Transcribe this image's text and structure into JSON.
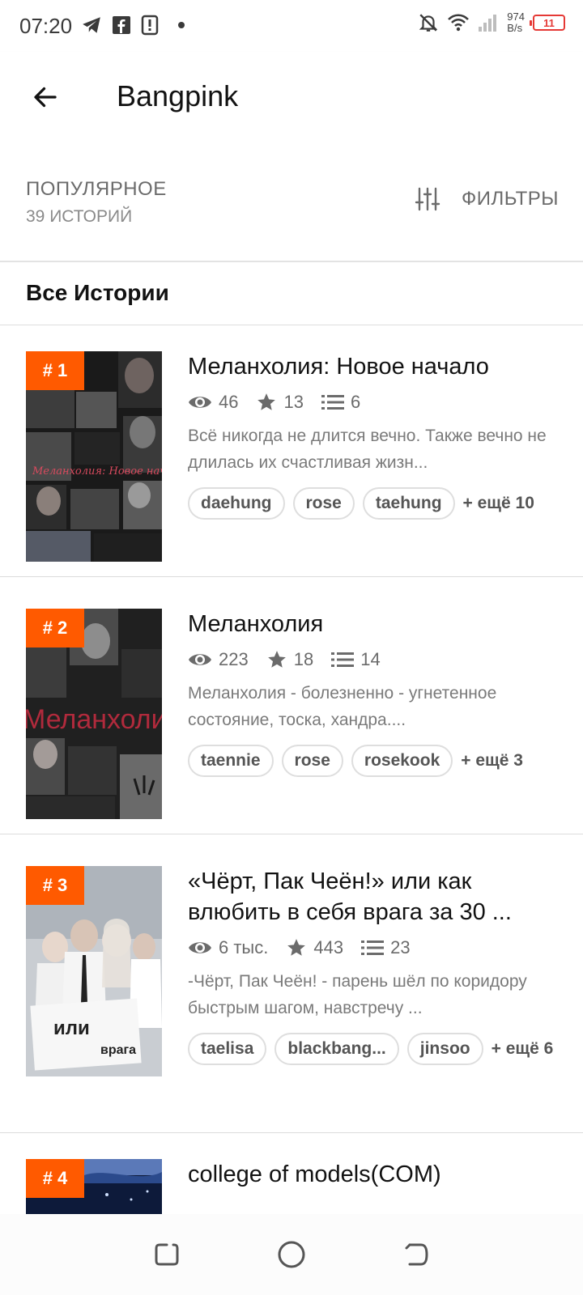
{
  "status_bar": {
    "time": "07:20",
    "net_speed_value": "974",
    "net_speed_unit": "B/s",
    "battery": "11"
  },
  "app_bar": {
    "title": "Bangpink"
  },
  "sort": {
    "title": "ПОПУЛЯРНОЕ",
    "count": "39 ИСТОРИЙ",
    "filters_label": "ФИЛЬТРЫ"
  },
  "section": {
    "title": "Все Истории"
  },
  "colors": {
    "accent": "#ff5a00",
    "text": "#121212",
    "muted": "#6b6b6b"
  },
  "stories": [
    {
      "rank": "# 1",
      "title": "Меланхолия: Новое начало",
      "views": "46",
      "votes": "13",
      "parts": "6",
      "description": "Всё никогда не длится вечно. Также вечно не длилась их счастливая жизн...",
      "tags": [
        "daehung",
        "rose",
        "taehung"
      ],
      "more": "+ ещё 10",
      "cover_text": "Меланхолия: Новое начало"
    },
    {
      "rank": "# 2",
      "title": "Меланхолия",
      "views": "223",
      "votes": "18",
      "parts": "14",
      "description": "Меланхолия - болезненно - угнетенное состояние, тоска, хандра....",
      "tags": [
        "taennie",
        "rose",
        "rosekook"
      ],
      "more": "+ ещё 3",
      "cover_text": "Меланхоли"
    },
    {
      "rank": "# 3",
      "title": "«Чёрт, Пак Чеён!» или как влюбить в себя врага за 30 ...",
      "views": "6 тыс.",
      "votes": "443",
      "parts": "23",
      "description": "-Чёрт, Пак Чеён! - парень шёл по коридору быстрым шагом, навстречу ...",
      "tags": [
        "taelisa",
        "blackbang...",
        "jinsoo"
      ],
      "more": "+ ещё 6",
      "cover_text_1": "или",
      "cover_text_2": "врага"
    },
    {
      "rank": "# 4",
      "title": "college of models(COM)"
    }
  ],
  "icons": [
    "telegram-icon",
    "facebook-icon",
    "alert-icon",
    "mute-icon",
    "wifi-icon",
    "signal-icon",
    "back-arrow-icon",
    "sliders-icon",
    "eye-icon",
    "star-icon",
    "list-icon",
    "recents-icon",
    "home-icon",
    "back-nav-icon"
  ]
}
